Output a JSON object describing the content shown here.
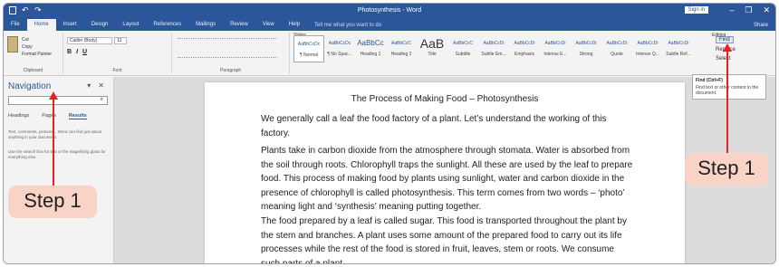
{
  "titlebar": {
    "title": "Photosynthesis - Word",
    "signin": "Sign in",
    "min": "–",
    "restore": "❐",
    "close": "✕",
    "undo": "↶",
    "redo": "↷"
  },
  "tabs": {
    "items": [
      "File",
      "Home",
      "Insert",
      "Design",
      "Layout",
      "References",
      "Mailings",
      "Review",
      "View",
      "Help"
    ],
    "tellme": "Tell me what you want to do",
    "share": "Share"
  },
  "ribbon": {
    "clipboard": {
      "label": "Clipboard",
      "paste": "Paste",
      "cut": "Cut",
      "copy": "Copy",
      "format_painter": "Format Painter"
    },
    "font": {
      "label": "Font",
      "name": "Calibri (Body)",
      "size": "12",
      "bold": "B",
      "italic": "I",
      "underline": "U"
    },
    "paragraph": {
      "label": "Paragraph"
    },
    "styles": {
      "label": "Styles",
      "items": [
        {
          "sample": "AaBbCcDc",
          "name": "¶ Normal"
        },
        {
          "sample": "AaBbCcDc",
          "name": "¶ No Spac..."
        },
        {
          "sample": "AaBbCc",
          "name": "Heading 1"
        },
        {
          "sample": "AaBbCcC",
          "name": "Heading 2"
        },
        {
          "sample": "AaB",
          "name": "Title"
        },
        {
          "sample": "AaBbCcC",
          "name": "Subtitle"
        },
        {
          "sample": "AaBbCcDi",
          "name": "Subtle Em..."
        },
        {
          "sample": "AaBbCcDi",
          "name": "Emphasis"
        },
        {
          "sample": "AaBbCcDi",
          "name": "Intense E..."
        },
        {
          "sample": "AaBbCcDi",
          "name": "Strong"
        },
        {
          "sample": "AaBbCcDi",
          "name": "Quote"
        },
        {
          "sample": "AaBbCcDi",
          "name": "Intense Q..."
        },
        {
          "sample": "AaBbCcDi",
          "name": "Subtle Ref..."
        },
        {
          "sample": "AaBbCcDi",
          "name": "Intense Re..."
        },
        {
          "sample": "AaBbCcDi",
          "name": "Book Title"
        }
      ]
    },
    "editing": {
      "label": "Editing",
      "find": "Find",
      "replace": "Replace",
      "select": "Select"
    }
  },
  "tooltip": {
    "title": "Find (Ctrl+F)",
    "body": "Find text or other content in the document."
  },
  "nav": {
    "title": "Navigation",
    "pin": "▾",
    "close": "✕",
    "search_placeholder": "",
    "search_icon": "⌕",
    "tabs": [
      "Headings",
      "Pages",
      "Results"
    ],
    "active_tab": "Results",
    "text1": "Text, comments, pictures... Word can find just about anything in your document.",
    "text2": "Use the search box for text or the magnifying glass for everything else."
  },
  "document": {
    "title": "The Process of Making Food – Photosynthesis",
    "paragraphs": [
      "We generally call a leaf the food factory of a plant. Let’s understand the working of this factory.",
      "Plants take in carbon dioxide from the atmosphere through stomata. Water is absorbed from the soil through roots. Chlorophyll traps the sunlight. All these are used by the leaf to prepare food. This process of making food by plants using sunlight, water and carbon dioxide in the presence of chlorophyll is called photosynthesis. This term comes from two words – ‘photo’ meaning light and ‘synthesis’ meaning putting together.",
      "The food prepared by a leaf is called sugar. This food is transported throughout the plant by the stem and branches. A plant uses some amount of the prepared food to carry out its life processes while the rest of the food is stored in fruit, leaves, stem or roots. We consume such parts of a plant."
    ]
  },
  "annotations": {
    "left_step": "Step 1",
    "right_step": "Step 1",
    "arrow_color": "#e8201f",
    "callout_color": "#f8d3c6"
  },
  "colors": {
    "word_blue": "#2b579a",
    "ribbon_bg": "#f3f3f3",
    "doc_bg": "#dcdcdc"
  }
}
